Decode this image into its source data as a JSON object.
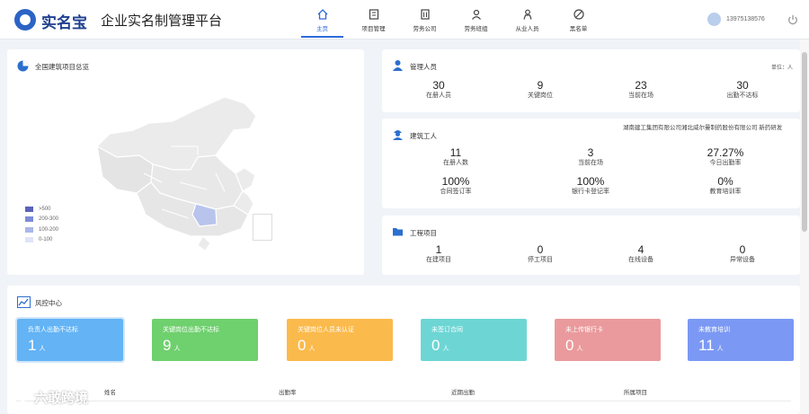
{
  "header": {
    "logo_text": "实名宝",
    "platform_title": "企业实名制管理平台",
    "nav": [
      {
        "label": "主页",
        "icon": "home-icon",
        "active": true
      },
      {
        "label": "项目管理",
        "icon": "project-icon",
        "active": false
      },
      {
        "label": "劳务公司",
        "icon": "building-icon",
        "active": false
      },
      {
        "label": "劳务班组",
        "icon": "team-icon",
        "active": false
      },
      {
        "label": "从业人员",
        "icon": "worker-icon",
        "active": false
      },
      {
        "label": "黑名单",
        "icon": "blacklist-icon",
        "active": false
      }
    ],
    "user_phone": "13975138576"
  },
  "map_panel": {
    "title": "全国建筑项目总览",
    "legend": [
      {
        "label": ">500",
        "color": "#5a63b8"
      },
      {
        "label": "200-300",
        "color": "#7d8bd8"
      },
      {
        "label": "100-200",
        "color": "#a9b6e8"
      },
      {
        "label": "0-100",
        "color": "#dfe5f5"
      }
    ]
  },
  "managers": {
    "title": "管理人员",
    "unit": "单位：人",
    "stats": [
      {
        "value": "30",
        "label": "在册人员"
      },
      {
        "value": "9",
        "label": "关键岗位"
      },
      {
        "value": "23",
        "label": "当前在场"
      },
      {
        "value": "30",
        "label": "出勤不达标"
      }
    ]
  },
  "workers": {
    "title": "建筑工人",
    "stats": [
      {
        "value": "11",
        "label": "在册人数"
      },
      {
        "value": "3",
        "label": "当前在场"
      },
      {
        "value": "27.27%",
        "label": "今日出勤率"
      },
      {
        "value": "100%",
        "label": "合同签订率"
      },
      {
        "value": "100%",
        "label": "银行卡登记率"
      },
      {
        "value": "0%",
        "label": "教育培训率"
      }
    ]
  },
  "projects": {
    "title": "工程项目",
    "stats": [
      {
        "value": "1",
        "label": "在建项目"
      },
      {
        "value": "0",
        "label": "停工项目"
      },
      {
        "value": "4",
        "label": "在线设备"
      },
      {
        "value": "0",
        "label": "异常设备"
      }
    ]
  },
  "risk": {
    "title": "风控中心",
    "unit": "人",
    "boxes": [
      {
        "label": "负责人出勤不达标",
        "value": "1",
        "color": "#63b3f5"
      },
      {
        "label": "关键岗位出勤不达标",
        "value": "9",
        "color": "#6fd06e"
      },
      {
        "label": "关键岗位人员未认证",
        "value": "0",
        "color": "#fbba4c"
      },
      {
        "label": "未签订合同",
        "value": "0",
        "color": "#6dd6d4"
      },
      {
        "label": "未上传银行卡",
        "value": "0",
        "color": "#ea9a9c"
      },
      {
        "label": "未教育培训",
        "value": "11",
        "color": "#7b99f4"
      }
    ],
    "columns": [
      "姓名",
      "出勤率",
      "近期出勤",
      "所属项目"
    ],
    "first_row_project": "湖南建工集团有限公司湘北威尔曼制药股份有限公司 新药研发"
  },
  "watermark": "六敢跨境"
}
